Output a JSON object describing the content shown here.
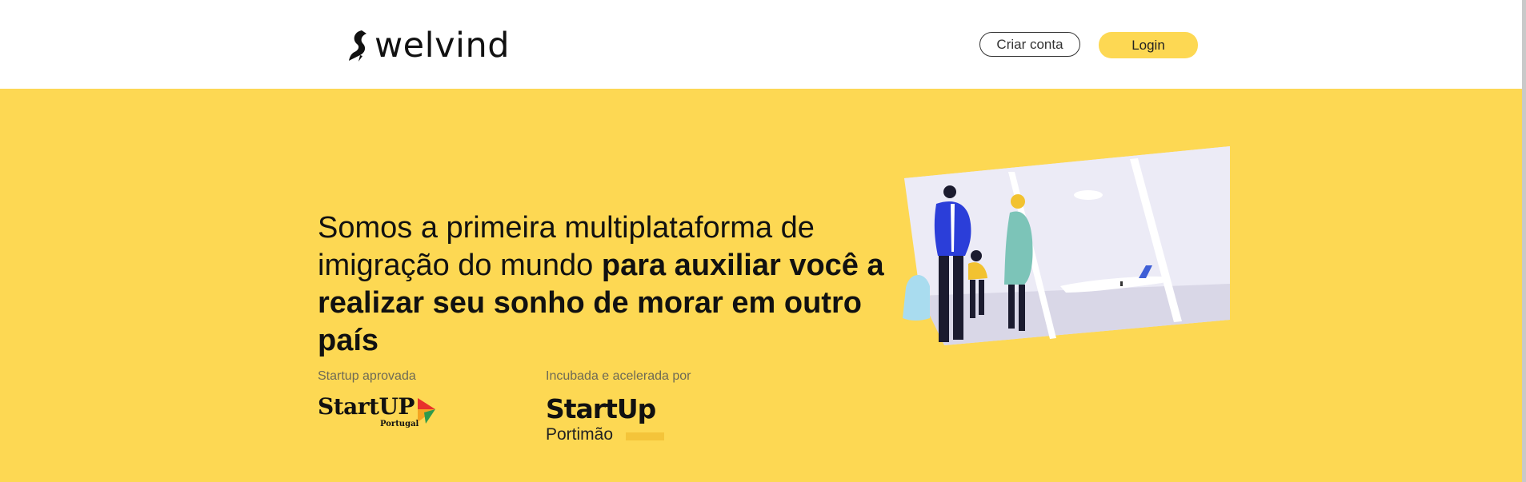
{
  "header": {
    "logo_text": "welvind",
    "logo_icon": "bird-silhouette-icon",
    "signup_label": "Criar conta",
    "login_label": "Login"
  },
  "hero": {
    "headline_regular": "Somos a primeira multiplataforma de imigração do mundo ",
    "headline_bold": "para auxiliar você a realizar seu sonho de morar em outro país",
    "badge1_label": "Startup aprovada",
    "badge1_logo_main": "StartUP",
    "badge1_logo_sub": "Portugal",
    "badge2_label": "Incubada e acelerada por",
    "badge2_logo_main": "StartUp",
    "badge2_logo_sub": "Portimão",
    "illustration": "family-airport-illustration"
  },
  "colors": {
    "brand_yellow": "#fdd853",
    "text_dark": "#111111",
    "muted_text": "#6e6a55"
  }
}
